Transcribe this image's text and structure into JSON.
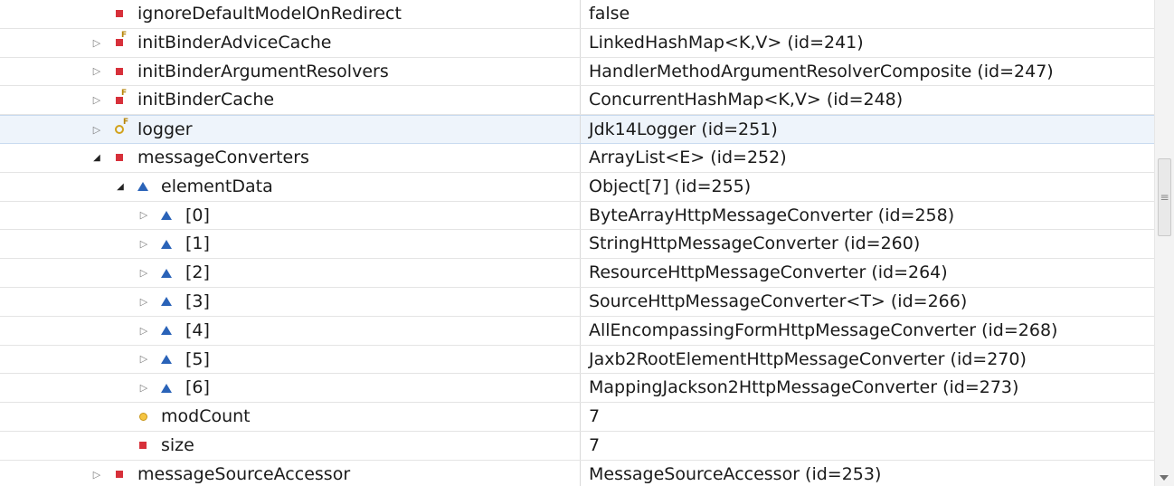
{
  "rows": [
    {
      "name": "ignoreDefaultModelOnRedirect",
      "value": "false",
      "toggle": "",
      "icon": "private-field-icon",
      "depth": 0,
      "selected": false
    },
    {
      "name": "initBinderAdviceCache",
      "value": "LinkedHashMap<K,V>  (id=241)",
      "toggle": "▷",
      "icon": "private-final-field-icon",
      "depth": 0,
      "selected": false
    },
    {
      "name": "initBinderArgumentResolvers",
      "value": "HandlerMethodArgumentResolverComposite  (id=247)",
      "toggle": "▷",
      "icon": "private-field-icon",
      "depth": 0,
      "selected": false
    },
    {
      "name": "initBinderCache",
      "value": "ConcurrentHashMap<K,V>  (id=248)",
      "toggle": "▷",
      "icon": "private-final-field-icon",
      "depth": 0,
      "selected": false
    },
    {
      "name": "logger",
      "value": "Jdk14Logger  (id=251)",
      "toggle": "▷",
      "icon": "protected-final-field-icon",
      "depth": 0,
      "selected": true
    },
    {
      "name": "messageConverters",
      "value": "ArrayList<E>  (id=252)",
      "toggle": "◢",
      "icon": "private-field-icon",
      "depth": 0,
      "selected": false
    },
    {
      "name": "elementData",
      "value": "Object[7]  (id=255)",
      "toggle": "◢",
      "icon": "package-field-icon",
      "depth": 1,
      "selected": false
    },
    {
      "name": "[0]",
      "value": "ByteArrayHttpMessageConverter  (id=258)",
      "toggle": "▷",
      "icon": "package-field-icon",
      "depth": 2,
      "selected": false
    },
    {
      "name": "[1]",
      "value": "StringHttpMessageConverter  (id=260)",
      "toggle": "▷",
      "icon": "package-field-icon",
      "depth": 2,
      "selected": false
    },
    {
      "name": "[2]",
      "value": "ResourceHttpMessageConverter  (id=264)",
      "toggle": "▷",
      "icon": "package-field-icon",
      "depth": 2,
      "selected": false
    },
    {
      "name": "[3]",
      "value": "SourceHttpMessageConverter<T>  (id=266)",
      "toggle": "▷",
      "icon": "package-field-icon",
      "depth": 2,
      "selected": false
    },
    {
      "name": "[4]",
      "value": "AllEncompassingFormHttpMessageConverter  (id=268)",
      "toggle": "▷",
      "icon": "package-field-icon",
      "depth": 2,
      "selected": false
    },
    {
      "name": "[5]",
      "value": "Jaxb2RootElementHttpMessageConverter  (id=270)",
      "toggle": "▷",
      "icon": "package-field-icon",
      "depth": 2,
      "selected": false
    },
    {
      "name": "[6]",
      "value": "MappingJackson2HttpMessageConverter  (id=273)",
      "toggle": "▷",
      "icon": "package-field-icon",
      "depth": 2,
      "selected": false
    },
    {
      "name": "modCount",
      "value": "7",
      "toggle": "",
      "icon": "protected-field-icon",
      "depth": 1,
      "selected": false
    },
    {
      "name": "size",
      "value": "7",
      "toggle": "",
      "icon": "private-field-icon",
      "depth": 1,
      "selected": false
    },
    {
      "name": "messageSourceAccessor",
      "value": "MessageSourceAccessor  (id=253)",
      "toggle": "▷",
      "icon": "private-field-icon",
      "depth": 0,
      "selected": false
    }
  ],
  "colors": {
    "private": "#d7303a",
    "package": "#2a63b8",
    "protected": "#f5c542",
    "selection": "#eef4fb"
  }
}
